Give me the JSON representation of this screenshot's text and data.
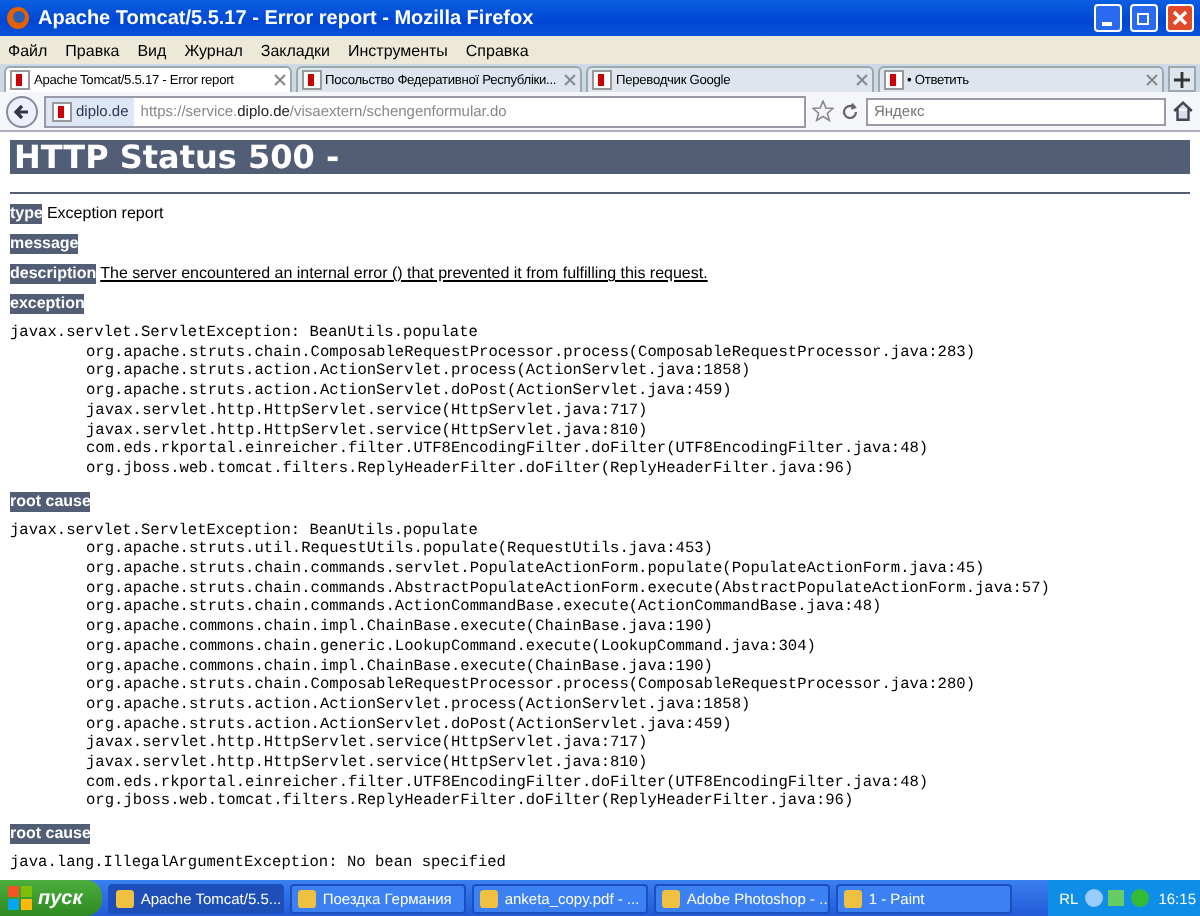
{
  "window": {
    "title": "Apache Tomcat/5.5.17 - Error report - Mozilla Firefox"
  },
  "menu": [
    "Файл",
    "Правка",
    "Вид",
    "Журнал",
    "Закладки",
    "Инструменты",
    "Справка"
  ],
  "tabs": [
    {
      "title": "Apache Tomcat/5.5.17 - Error report",
      "selected": true
    },
    {
      "title": "Посольство Федеративної Республіки...",
      "selected": false
    },
    {
      "title": "Переводчик Google",
      "selected": false
    },
    {
      "title": "• Ответить",
      "selected": false
    }
  ],
  "address": {
    "site": "diplo.de",
    "url": "https://service.**diplo.de**/visaextern/schengenformular.do"
  },
  "search": {
    "placeholder": "Яндекс"
  },
  "page": {
    "heading": "HTTP Status 500 -",
    "blocks": [
      {
        "kind": "field",
        "label": "type",
        "text": "Exception report"
      },
      {
        "kind": "field",
        "label": "message"
      },
      {
        "kind": "field",
        "label": "description",
        "text": "The server encountered an internal error () that prevented it from fulfilling this request.",
        "underline": true
      },
      {
        "kind": "field",
        "label": "exception"
      },
      {
        "kind": "trace",
        "head": "javax.servlet.ServletException: BeanUtils.populate",
        "frames": [
          "org.apache.struts.chain.ComposableRequestProcessor.process(ComposableRequestProcessor.java:283)",
          "org.apache.struts.action.ActionServlet.process(ActionServlet.java:1858)",
          "org.apache.struts.action.ActionServlet.doPost(ActionServlet.java:459)",
          "javax.servlet.http.HttpServlet.service(HttpServlet.java:717)",
          "javax.servlet.http.HttpServlet.service(HttpServlet.java:810)",
          "com.eds.rkportal.einreicher.filter.UTF8EncodingFilter.doFilter(UTF8EncodingFilter.java:48)",
          "org.jboss.web.tomcat.filters.ReplyHeaderFilter.doFilter(ReplyHeaderFilter.java:96)"
        ]
      },
      {
        "kind": "field",
        "label": "root cause"
      },
      {
        "kind": "trace",
        "head": "javax.servlet.ServletException: BeanUtils.populate",
        "frames": [
          "org.apache.struts.util.RequestUtils.populate(RequestUtils.java:453)",
          "org.apache.struts.chain.commands.servlet.PopulateActionForm.populate(PopulateActionForm.java:45)",
          "org.apache.struts.chain.commands.AbstractPopulateActionForm.execute(AbstractPopulateActionForm.java:57)",
          "org.apache.struts.chain.commands.ActionCommandBase.execute(ActionCommandBase.java:48)",
          "org.apache.commons.chain.impl.ChainBase.execute(ChainBase.java:190)",
          "org.apache.commons.chain.generic.LookupCommand.execute(LookupCommand.java:304)",
          "org.apache.commons.chain.impl.ChainBase.execute(ChainBase.java:190)",
          "org.apache.struts.chain.ComposableRequestProcessor.process(ComposableRequestProcessor.java:280)",
          "org.apache.struts.action.ActionServlet.process(ActionServlet.java:1858)",
          "org.apache.struts.action.ActionServlet.doPost(ActionServlet.java:459)",
          "javax.servlet.http.HttpServlet.service(HttpServlet.java:717)",
          "javax.servlet.http.HttpServlet.service(HttpServlet.java:810)",
          "com.eds.rkportal.einreicher.filter.UTF8EncodingFilter.doFilter(UTF8EncodingFilter.java:48)",
          "org.jboss.web.tomcat.filters.ReplyHeaderFilter.doFilter(ReplyHeaderFilter.java:96)"
        ]
      },
      {
        "kind": "field",
        "label": "root cause"
      },
      {
        "kind": "trace",
        "head": "java.lang.IllegalArgumentException: No bean specified"
      }
    ]
  },
  "taskbar": {
    "start": "пуск",
    "tasks": [
      {
        "title": "Apache Tomcat/5.5...",
        "selected": true
      },
      {
        "title": "Поездка Германия",
        "selected": false
      },
      {
        "title": "anketa_copy.pdf - ...",
        "selected": false
      },
      {
        "title": "Adobe Photoshop - ...",
        "selected": false
      },
      {
        "title": "1 - Paint",
        "selected": false
      }
    ],
    "language": "RL",
    "clock": "16:15"
  }
}
